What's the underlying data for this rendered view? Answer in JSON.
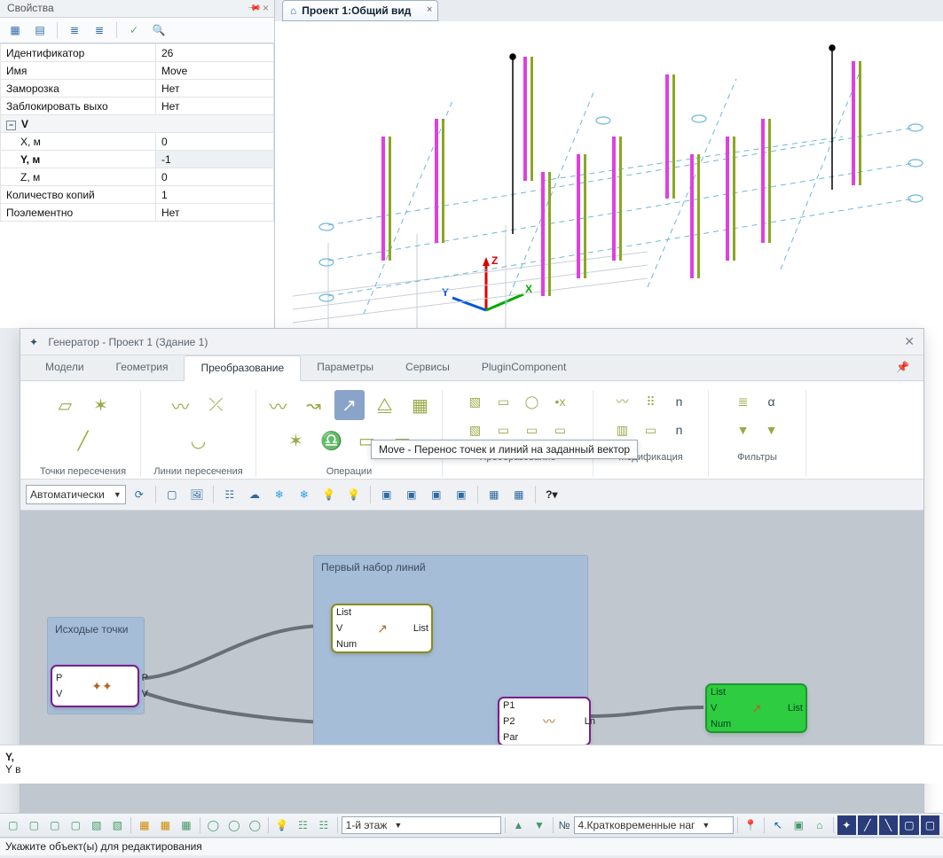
{
  "properties_panel": {
    "title": "Свойства",
    "rows": [
      {
        "key": "Идентификатор",
        "val": "26"
      },
      {
        "key": "Имя",
        "val": "Move"
      },
      {
        "key": "Заморозка",
        "val": "Нет"
      },
      {
        "key": "Заблокировать выхо",
        "val": "Нет"
      }
    ],
    "group_label": "V",
    "vector": [
      {
        "key": "X, м",
        "val": "0"
      },
      {
        "key": "Y, м",
        "val": "-1",
        "shade": true
      },
      {
        "key": "Z, м",
        "val": "0"
      }
    ],
    "rows2": [
      {
        "key": "Количество копий",
        "val": "1"
      },
      {
        "key": "Поэлементно",
        "val": "Нет"
      }
    ]
  },
  "viewport_tab": {
    "title": "Проект 1:Общий вид"
  },
  "generator": {
    "title": "Генератор - Проект 1 (Здание 1)",
    "tabs": [
      "Модели",
      "Геометрия",
      "Преобразование",
      "Параметры",
      "Сервисы",
      "PluginComponent"
    ],
    "active_tab_index": 2,
    "ribbon_groups": [
      "Точки пересечения",
      "Линии пересечения",
      "Операции",
      "Преобразование",
      "Модификация",
      "Фильтры"
    ],
    "tooltip": "Move - Перенос точек и линий на заданный вектор",
    "toolbar_dropdown": "Автоматически",
    "group_boxes": {
      "left": {
        "title": "Исходые точки"
      },
      "big": {
        "title": "Первый набор линий"
      }
    },
    "nodes": {
      "src": {
        "ports_l": [
          "P",
          "V"
        ],
        "ports_r": [
          "P",
          "V"
        ]
      },
      "move": {
        "ports_l": [
          "List",
          "V",
          "Num"
        ],
        "ports_r": [
          "List"
        ]
      },
      "line": {
        "ports_l": [
          "P1",
          "P2",
          "Par"
        ],
        "ports_r": [
          "Ln"
        ]
      },
      "move2": {
        "ports_l": [
          "List",
          "V",
          "Num"
        ],
        "ports_r": [
          "List"
        ]
      }
    }
  },
  "info_strip": {
    "line1": "Y,",
    "line2": "Y в"
  },
  "status_bar": {
    "floor_dropdown": "1-й этаж",
    "load_prefix": "№",
    "load_dropdown": "4.Кратковременные наг",
    "message": "Укажите объект(ы) для редактирования"
  }
}
